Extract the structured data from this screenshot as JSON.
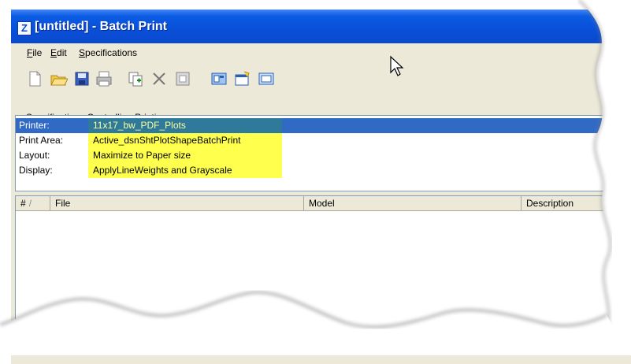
{
  "window": {
    "title": "[untitled] - Batch Print",
    "app_icon": "batch-print-app-icon"
  },
  "menu": {
    "items": [
      {
        "underline": "F",
        "rest": "ile"
      },
      {
        "underline": "E",
        "rest": "dit"
      },
      {
        "underline": "S",
        "rest": "pecifications"
      }
    ]
  },
  "toolbar": {
    "buttons": [
      "new-document-icon",
      "open-folder-icon",
      "save-icon",
      "print-icon",
      "add-files-icon",
      "delete-icon",
      "clear-icon",
      "printer-setup-icon",
      "specification-settings-icon",
      "print-preview-icon"
    ]
  },
  "section_label": "Specifications Controlling Printing",
  "specifications": [
    {
      "key": "Printer:",
      "value": "11x17_bw_PDF_Plots",
      "selected": true
    },
    {
      "key": "Print Area:",
      "value": "Active_dsnShtPlotShapeBatchPrint",
      "selected": false
    },
    {
      "key": "Layout:",
      "value": "Maximize to Paper size",
      "selected": false
    },
    {
      "key": "Display:",
      "value": "ApplyLineWeights and Grayscale",
      "selected": false
    }
  ],
  "file_table": {
    "columns": [
      "#",
      "File",
      "Model",
      "Description"
    ],
    "sort_indicator": "/",
    "rows": []
  },
  "colors": {
    "titlebar": "#0a4fd8",
    "selection": "#316ac5",
    "highlight": "#ffff4d",
    "window_bg": "#ece9d8"
  }
}
